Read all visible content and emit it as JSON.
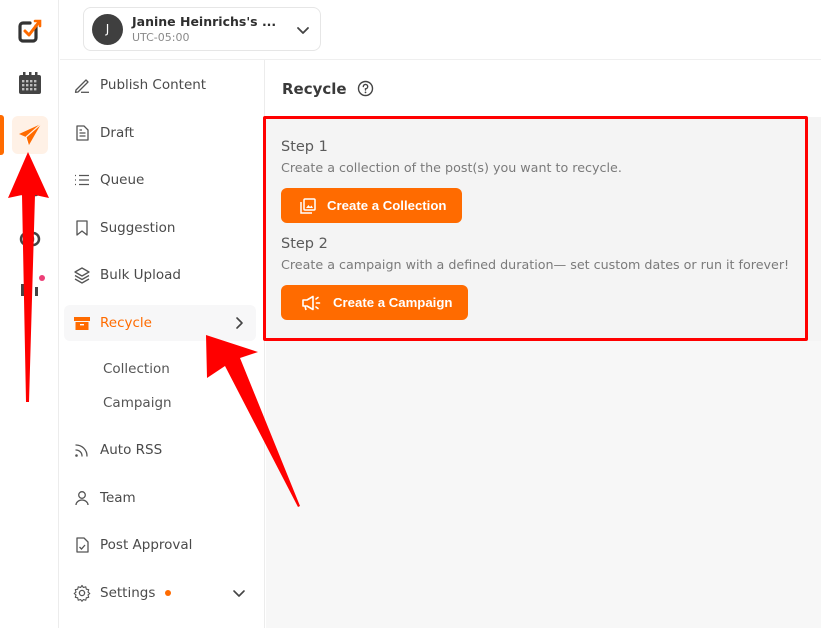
{
  "rail": {
    "items": [
      {
        "name": "logo",
        "icon": "check-square-logo-icon"
      },
      {
        "name": "calendar",
        "icon": "calendar-icon"
      },
      {
        "name": "publish",
        "icon": "paper-plane-icon",
        "active": true
      },
      {
        "name": "inbox",
        "icon": "inbox-icon"
      },
      {
        "name": "support",
        "icon": "chat-icon"
      },
      {
        "name": "analytics",
        "icon": "analytics-icon",
        "badge_dot": true
      }
    ],
    "accent_color": "#ff6b00",
    "dot_color": "#ec3f77"
  },
  "workspace": {
    "avatar_initial": "J",
    "name": "Janine Heinrichs's ...",
    "timezone": "UTC-05:00"
  },
  "subnav": {
    "items": [
      {
        "label": "Publish Content",
        "icon": "pen-icon"
      },
      {
        "label": "Draft",
        "icon": "document-icon"
      },
      {
        "label": "Queue",
        "icon": "list-icon"
      },
      {
        "label": "Suggestion",
        "icon": "bookmark-icon"
      },
      {
        "label": "Bulk Upload",
        "icon": "layers-icon"
      },
      {
        "label": "Recycle",
        "icon": "archive-box-icon",
        "active": true
      },
      {
        "label": "Auto RSS",
        "icon": "rss-icon"
      },
      {
        "label": "Team",
        "icon": "user-icon"
      },
      {
        "label": "Post Approval",
        "icon": "document-check-icon"
      },
      {
        "label": "Settings",
        "icon": "gear-icon",
        "badge_dot": true
      }
    ],
    "recycle_children": [
      "Collection",
      "Campaign"
    ]
  },
  "main": {
    "title": "Recycle",
    "step1": {
      "title": "Step 1",
      "description": "Create a collection of the post(s) you want to recycle.",
      "button": "Create a Collection"
    },
    "step2": {
      "title": "Step 2",
      "description": "Create a campaign with a defined duration— set custom dates or run it forever!",
      "button": "Create a Campaign"
    }
  },
  "colors": {
    "brand_orange": "#ff6b00",
    "annotation_red": "#ff0000",
    "panel_bg": "#f4f4f4"
  }
}
